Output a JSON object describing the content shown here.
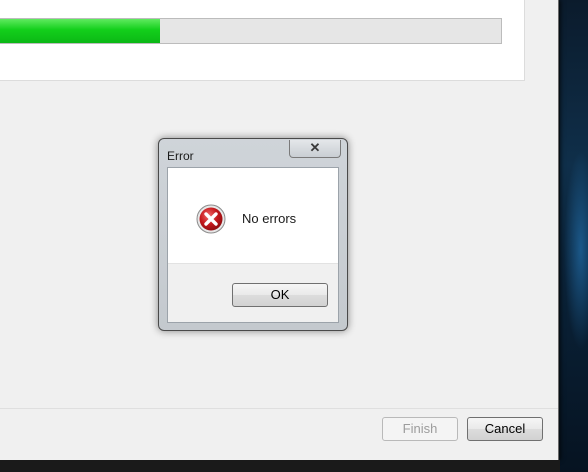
{
  "installer": {
    "progress_fraction": 0.32,
    "buttons": {
      "finish_label": "Finish",
      "cancel_label": "Cancel"
    }
  },
  "dialog": {
    "title": "Error",
    "close_glyph": "✕",
    "icon": "error-icon",
    "message": "No errors",
    "ok_label": "OK"
  },
  "colors": {
    "progress_fill": "#13cf1b",
    "error_red": "#c4171b"
  }
}
